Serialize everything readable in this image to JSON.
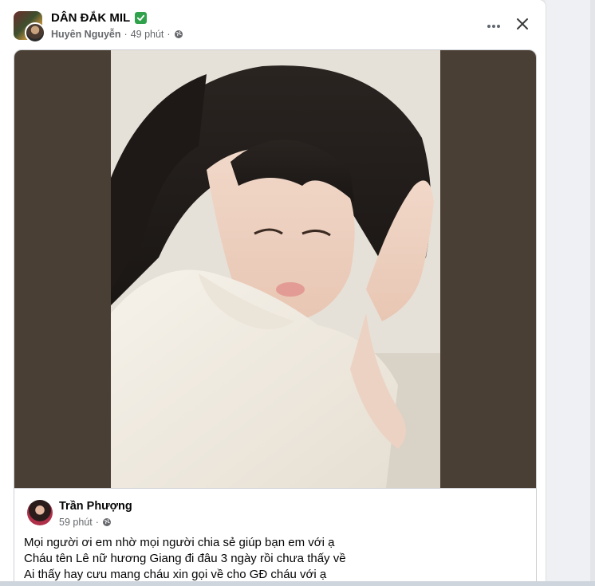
{
  "post": {
    "group_name": "DÂN ĐẮK MIL",
    "author": "Huyên Nguyễn",
    "separator": "·",
    "time": "49 phút",
    "privacy_icon": "globe-icon",
    "verified_icon": "verified-check-icon",
    "actions": {
      "more_icon": "more-icon",
      "close_icon": "close-icon"
    }
  },
  "shared_post": {
    "author": "Trần Phượng",
    "time": "59 phút",
    "separator": "·",
    "privacy_icon": "globe-icon",
    "text_lines": [
      "Mọi người ơi em nhờ mọi người chia sẻ giúp bạn em với ạ",
      "Cháu tên Lê nữ hương Giang đi đâu 3 ngày rồi chưa thấy về",
      "Ai thấy hay cưu mang cháu xin gọi về cho GĐ cháu với ạ"
    ]
  },
  "colors": {
    "verified": "#31a24c",
    "secondary_text": "#65676b",
    "photo_side_bars": "#4a3f34"
  }
}
